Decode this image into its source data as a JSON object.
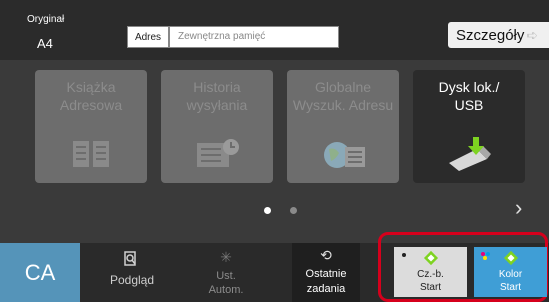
{
  "header": {
    "original_label": "Oryginał",
    "original_value": "A4",
    "address_label": "Adres",
    "address_placeholder": "Zewnętrzna pamięć",
    "details_label": "Szczegóły"
  },
  "tiles": [
    {
      "line1": "Książka",
      "line2": "Adresowa",
      "enabled": false,
      "icon": "address-book-icon"
    },
    {
      "line1": "Historia",
      "line2": "wysyłania",
      "enabled": false,
      "icon": "send-history-icon"
    },
    {
      "line1": "Globalne",
      "line2": "Wyszuk. Adresu",
      "enabled": false,
      "icon": "global-search-icon"
    },
    {
      "line1": "Dysk lok./",
      "line2": "USB",
      "enabled": true,
      "icon": "usb-drive-icon"
    }
  ],
  "pager": {
    "pages": 2,
    "current": 1
  },
  "bottom": {
    "ca": "CA",
    "preview": "Podgląd",
    "auto_line1": "Ust.",
    "auto_line2": "Autom.",
    "recent_line1": "Ostatnie",
    "recent_line2": "zadania",
    "bw_line1": "Cz.-b.",
    "bw_line2": "Start",
    "color_line1": "Kolor",
    "color_line2": "Start"
  },
  "colors": {
    "ca": "#5594b9",
    "color_start": "#3f9ed6",
    "bw_start": "#dcdcdc",
    "highlight": "#d6001c",
    "start_diamond": "#7ed321"
  }
}
